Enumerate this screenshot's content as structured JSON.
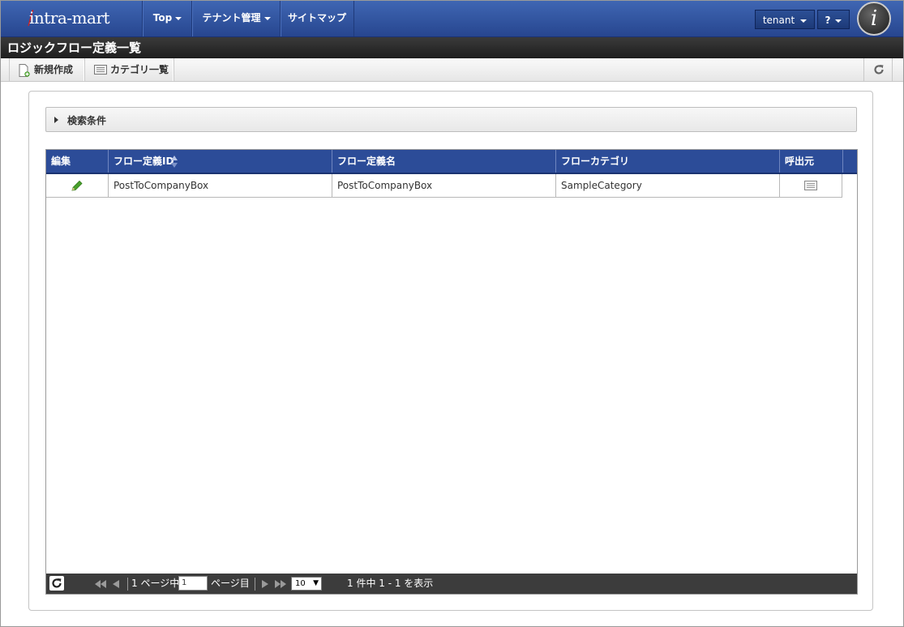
{
  "header": {
    "logo_text": "intra-mart",
    "nav": [
      {
        "label": "Top",
        "has_caret": true
      },
      {
        "label": "テナント管理",
        "has_caret": true
      },
      {
        "label": "サイトマップ",
        "has_caret": false
      }
    ],
    "user_button": "tenant",
    "help_button": "?"
  },
  "page": {
    "title": "ロジックフロー定義一覧"
  },
  "toolbar": {
    "new_label": "新規作成",
    "category_label": "カテゴリ一覧"
  },
  "search": {
    "label": "検索条件"
  },
  "grid": {
    "columns": [
      "編集",
      "フロー定義ID",
      "フロー定義名",
      "フローカテゴリ",
      "呼出元"
    ],
    "rows": [
      {
        "flow_id": "PostToCompanyBox",
        "flow_name": "PostToCompanyBox",
        "category": "SampleCategory"
      }
    ]
  },
  "pager": {
    "page_prefix": "1 ページ中",
    "page_value": "1",
    "page_suffix": "ページ目",
    "rows_per_page": "10",
    "summary": "1 件中 1 - 1 を表示"
  },
  "colors": {
    "nav_blue": "#2c4c98",
    "title_bar": "#1e1e1e",
    "edit_icon_green": "#4aa02c"
  },
  "icons": [
    "pencil-icon",
    "list-icon",
    "refresh-icon",
    "new-document-icon",
    "sort-icon"
  ]
}
